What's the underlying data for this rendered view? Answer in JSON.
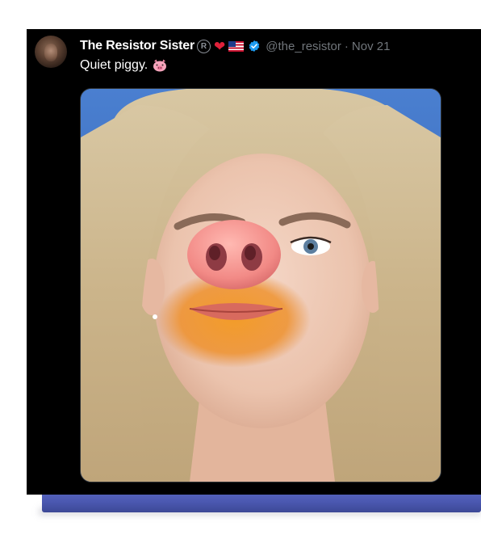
{
  "tweet": {
    "display_name": "The Resistor Sister",
    "registered_icon": "registered-mark-icon",
    "registered_glyph": "R",
    "heart_icon": "red-heart-icon",
    "flag_icon": "us-flag-icon",
    "verified_icon": "verified-badge-icon",
    "handle": "@the_resistor",
    "separator": "·",
    "timestamp": "Nov 21",
    "text": "Quiet piggy.",
    "text_emoji": "pig-face-icon",
    "media_description": "photo"
  },
  "colors": {
    "card_background": "#000000",
    "name_text": "#ffffff",
    "meta_text": "#71767b",
    "verified_blue": "#1d9bf0",
    "heart_red": "#e0213a",
    "shadow_band": "#4b58b0"
  }
}
